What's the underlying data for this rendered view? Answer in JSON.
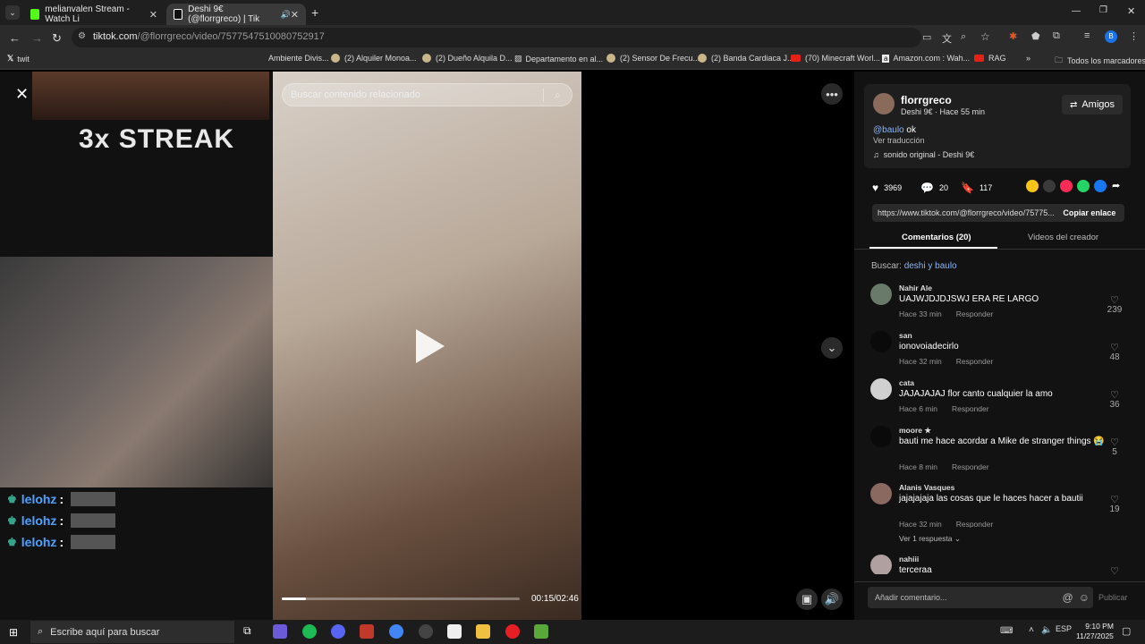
{
  "browser": {
    "tabs": [
      {
        "title": "melianvalen Stream - Watch Li",
        "color": "#53fc18",
        "active": false
      },
      {
        "title": "Deshi 9€ (@florrgreco) | Tik",
        "color": "#ffffff",
        "active": true
      }
    ],
    "new_tab": "+",
    "url_host": "tiktok.com",
    "url_path": "/@florrgreco/video/7577547510080752917",
    "bookmarks": [
      {
        "label": "twit",
        "type": "x"
      },
      {
        "label": "Ambiente Divis...",
        "type": "plain"
      },
      {
        "label": "(2) Alquiler Monoa...",
        "type": "dot"
      },
      {
        "label": "(2) Dueño Alquila D...",
        "type": "dot"
      },
      {
        "label": "Departamento en al...",
        "type": "img"
      },
      {
        "label": "(2) Sensor De Frecu...",
        "type": "dot"
      },
      {
        "label": "(2) Banda Cardiaca J...",
        "type": "dot"
      },
      {
        "label": "(70) Minecraft Worl...",
        "type": "yt"
      },
      {
        "label": "Amazon.com : Wah...",
        "type": "amz"
      },
      {
        "label": "RAG",
        "type": "yt"
      }
    ],
    "all_bookmarks": "Todos los marcadores",
    "more_bookmarks": "»"
  },
  "stream": {
    "streak_text": "3x STREAK",
    "chat": [
      {
        "user": "lelohz",
        "sep": ":"
      },
      {
        "user": "lelohz",
        "sep": ":"
      },
      {
        "user": "lelohz",
        "sep": ":"
      }
    ]
  },
  "video": {
    "search_placeholder": "Buscar contenido relacionado",
    "time": "00:15/02:46",
    "progress": 0.1
  },
  "author": {
    "name": "florrgreco",
    "sub": "Deshi 9€ · Hace 55 min",
    "follow_label": "Amigos",
    "mention": "@baulo",
    "caption_rest": " ok",
    "translate": "Ver traducción",
    "music": "sonido original - Deshi 9€"
  },
  "stats": {
    "likes": "3969",
    "comments": "20",
    "saves": "117"
  },
  "share_colors": [
    "#f5c518",
    "#3a3a3a",
    "#fe2c55",
    "#25d366",
    "#1877f2"
  ],
  "link": {
    "url": "https://www.tiktok.com/@florrgreco/video/75775...",
    "copy_label": "Copiar enlace"
  },
  "panel_tabs": {
    "comments": "Comentarios (20)",
    "creator": "Videos del creador"
  },
  "search_hint": {
    "prefix": "Buscar: ",
    "term": "deshi y baulo"
  },
  "comments": [
    {
      "user": "Nahir Ale",
      "text": "UAJWJDJDJSWJ ERA RE LARGO",
      "time": "Hace 33 min",
      "reply": "Responder",
      "likes": "239",
      "avatar": "#6a7a6a"
    },
    {
      "user": "san",
      "text": "ionovoiadecirlo",
      "time": "Hace 32 min",
      "reply": "Responder",
      "likes": "48",
      "avatar": "#0a0a0a"
    },
    {
      "user": "cata",
      "text": "JAJAJAJAJ flor canto cualquier la amo",
      "time": "Hace 6 min",
      "reply": "Responder",
      "likes": "36",
      "avatar": "#d0d0d0"
    },
    {
      "user": "moore ★",
      "text": "bauti me hace acordar a Mike de stranger things 😭",
      "time": "Hace 8 min",
      "reply": "Responder",
      "likes": "5",
      "avatar": "#0a0a0a"
    },
    {
      "user": "Alanis Vasques",
      "text": "jajajajaja las cosas que le haces hacer a bautii",
      "time": "Hace 32 min",
      "reply": "Responder",
      "likes": "19",
      "avatar": "#8a6a60",
      "replies": "Ver 1 respuesta"
    },
    {
      "user": "nahiii",
      "text": "terceraa",
      "time": "",
      "reply": "",
      "likes": "",
      "avatar": "#b0a0a0"
    }
  ],
  "comment_input": {
    "placeholder": "Añadir comentario...",
    "publish": "Publicar"
  },
  "taskbar": {
    "search_placeholder": "Escribe aquí para buscar",
    "lang": "ESP",
    "time": "9:10 PM",
    "date": "11/27/2025"
  }
}
